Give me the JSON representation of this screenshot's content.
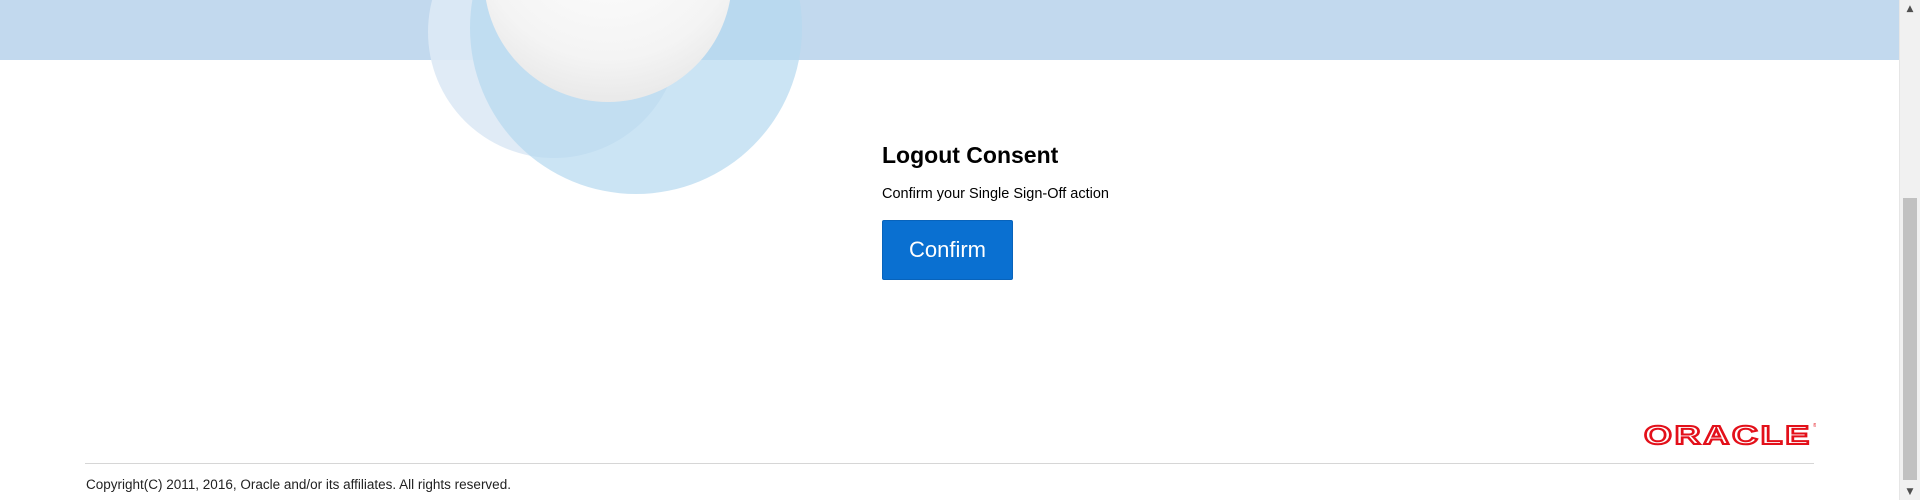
{
  "page": {
    "title": "Logout Consent",
    "subtitle": "Confirm your Single Sign-Off action",
    "confirm_label": "Confirm"
  },
  "footer": {
    "logo_text": "ORACLE",
    "copyright": "Copyright(C) 2011, 2016, Oracle and/or its affiliates. All rights reserved."
  },
  "scrollbar": {
    "up_icon": "scroll-up-arrow-icon",
    "down_icon": "scroll-down-arrow-icon"
  },
  "colors": {
    "header_band": "#c2d9ee",
    "primary_button": "#0a70d1",
    "oracle_red": "#e3101a"
  }
}
